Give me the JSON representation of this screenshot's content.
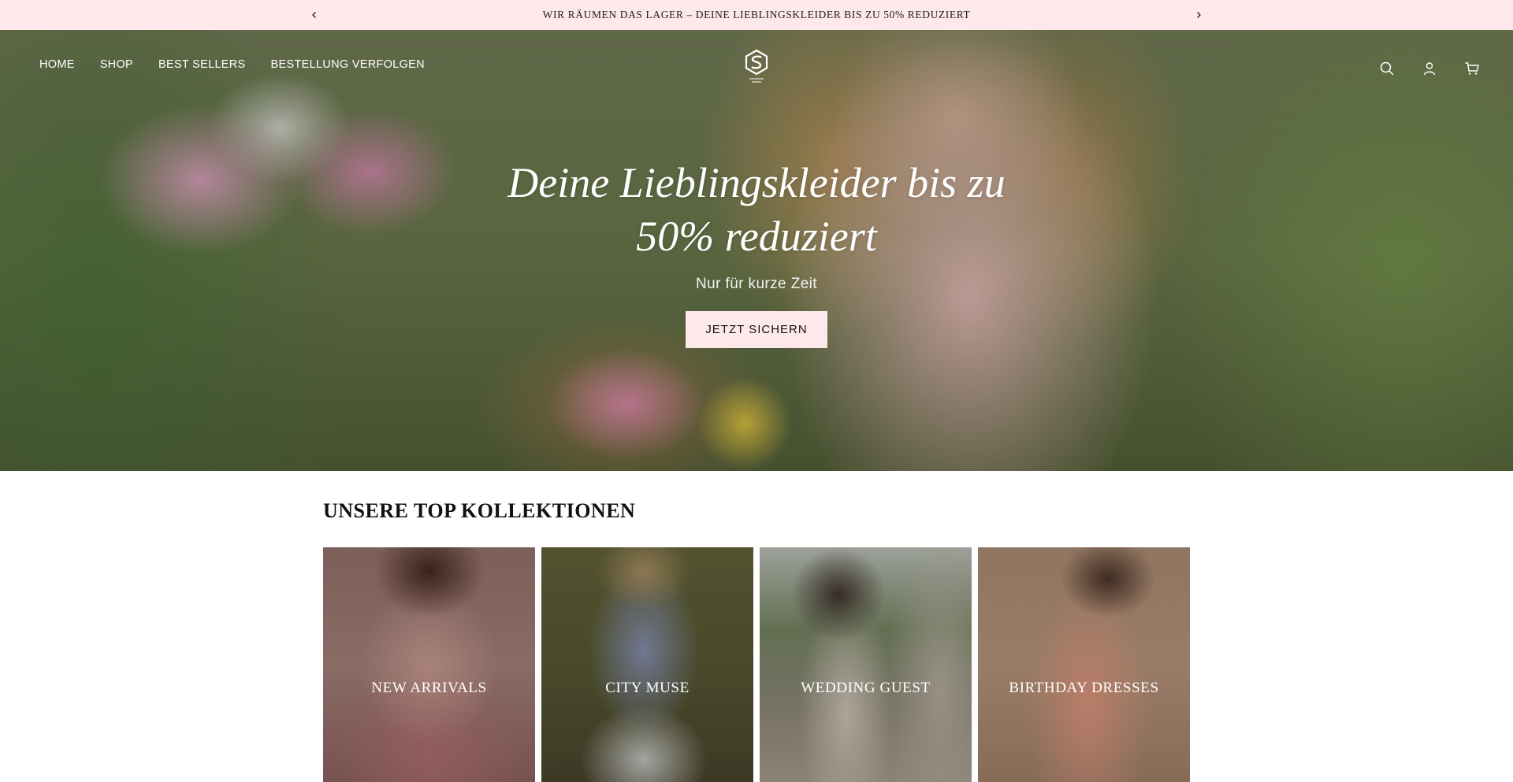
{
  "announcement": {
    "message": "WIR RÄUMEN DAS LAGER – DEINE LIEBLINGSKLEIDER BIS ZU 50% REDUZIERT"
  },
  "header": {
    "nav": [
      {
        "label": "HOME"
      },
      {
        "label": "SHOP"
      },
      {
        "label": "BEST SELLERS"
      },
      {
        "label": "BESTELLUNG VERFOLGEN"
      }
    ],
    "icons": [
      "search-icon",
      "account-icon",
      "cart-icon"
    ]
  },
  "hero": {
    "title": "Deine Lieblingskleider bis zu 50% reduziert",
    "subtitle": "Nur für kurze Zeit",
    "button_label": "JETZT SICHERN"
  },
  "collections": {
    "title": "UNSERE TOP KOLLEKTIONEN",
    "items": [
      {
        "label": "NEW ARRIVALS"
      },
      {
        "label": "CITY MUSE"
      },
      {
        "label": "WEDDING GUEST"
      },
      {
        "label": "BIRTHDAY DRESSES"
      }
    ]
  },
  "colors": {
    "announcement_bg": "#fde8eb",
    "button_bg": "#fde8eb",
    "text_dark": "#111111",
    "text_light": "#ffffff"
  }
}
